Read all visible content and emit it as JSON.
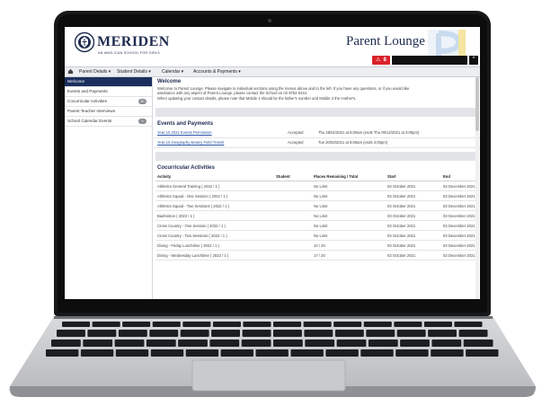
{
  "header": {
    "school_name": "MERIDEN",
    "school_tagline": "AN ANGLICAN SCHOOL FOR GIRLS",
    "portal_title": "Parent Lounge",
    "alert_count": "8"
  },
  "nav": {
    "items": [
      {
        "label": "Parent Details ▾"
      },
      {
        "label": "Student Details ▾"
      },
      {
        "label": "Calendar ▾"
      },
      {
        "label": "Accounts & Payments ▾"
      }
    ]
  },
  "sidebar": {
    "items": [
      {
        "label": "Welcome",
        "active": true
      },
      {
        "label": "Events and Payments"
      },
      {
        "label": "Cocurricular Activities",
        "badge": "60"
      },
      {
        "label": "Parent Teacher Interviews"
      },
      {
        "label": "School Calendar Events",
        "badge": "0"
      }
    ]
  },
  "welcome": {
    "title": "Welcome",
    "line1": "Welcome to Parent Lounge. Please navigate to individual sections using the menus above and to the left. If you have any questions, or if you would like",
    "line2": "assistance with any aspect of Parent Lounge, please contact the School on 02 9752 9444.",
    "line3": "When updating your contact details, please note that Mobile 1 should be the father's number and Mobile 2 the mother's."
  },
  "events": {
    "title": "Events and Payments",
    "rows": [
      {
        "name": "Year 10 2021 Events Permission",
        "status": "Accepted",
        "time": "Thu 28/01/2021 at 8:00am (ends Thu 09/12/2021 at 3:00pm)"
      },
      {
        "name": "Year 10 Geography Botany Field Transit",
        "status": "Accepted",
        "time": "Tue 20/03/2021 at 8:00am (ends 3:00pm)"
      }
    ]
  },
  "cocurricular": {
    "title": "Cocurricular Activities",
    "headers": {
      "activity": "Activity",
      "student": "Student",
      "places": "Places Remaining / Total",
      "start": "Start",
      "end": "End"
    },
    "rows": [
      {
        "activity": "Athletics General Training ( 2022 / 1 )",
        "places": "No Limit",
        "start": "03 October 2021",
        "end": "03 December 2021"
      },
      {
        "activity": "Athletics Squad - One Session ( 2022 / 1 )",
        "places": "No Limit",
        "start": "03 October 2021",
        "end": "03 December 2021"
      },
      {
        "activity": "Athletics Squad - Two Sessions ( 2022 / 1 )",
        "places": "No Limit",
        "start": "03 October 2021",
        "end": "03 December 2021"
      },
      {
        "activity": "Badminton ( 2022 / 1 )",
        "places": "No Limit",
        "start": "03 October 2021",
        "end": "03 December 2021"
      },
      {
        "activity": "Cross Country - One Session ( 2022 / 1 )",
        "places": "No Limit",
        "start": "03 October 2021",
        "end": "03 December 2021"
      },
      {
        "activity": "Cross Country - Two Sessions ( 2022 / 1 )",
        "places": "No Limit",
        "start": "03 October 2021",
        "end": "03 December 2021"
      },
      {
        "activity": "Diving - Friday Lunchtime ( 2022 / 1 )",
        "places": "10 / 20",
        "start": "03 October 2021",
        "end": "03 December 2021"
      },
      {
        "activity": "Diving - Wednesday Lunchtime ( 2022 / 1 )",
        "places": "17 / 20",
        "start": "03 October 2021",
        "end": "03 December 2021"
      }
    ]
  },
  "colors": {
    "navy": "#1b2f5e",
    "alert_red": "#d9222a",
    "link_blue": "#2a55a8"
  }
}
